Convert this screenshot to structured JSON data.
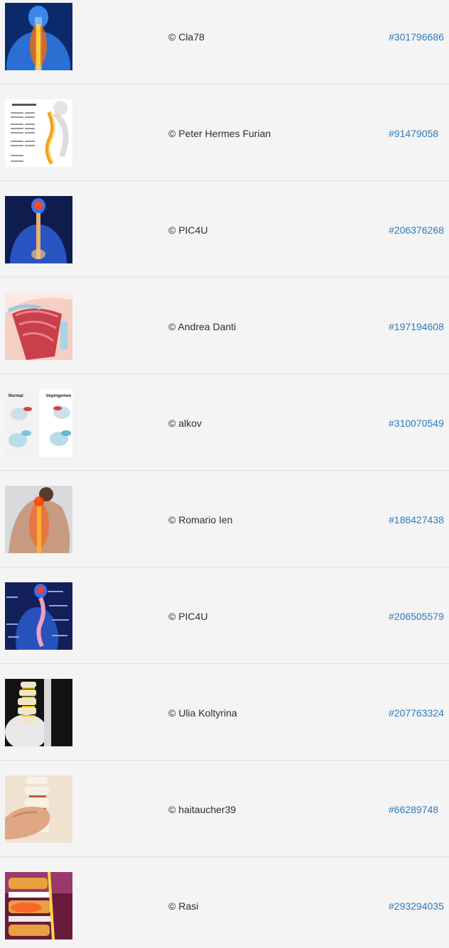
{
  "items": [
    {
      "credit": "© Cla78",
      "id": "#301796686",
      "image": "back-spine-pain-thumbnail"
    },
    {
      "credit": "© Peter Hermes Furian",
      "id": "#91479058",
      "image": "vertebrae-chart-thumbnail"
    },
    {
      "credit": "© PIC4U",
      "id": "#206376268",
      "image": "blue-body-spine-thumbnail"
    },
    {
      "credit": "© Andrea Danti",
      "id": "#197194608",
      "image": "shoulder-muscle-thumbnail"
    },
    {
      "credit": "© alkov",
      "id": "#310070549",
      "image": "shoulder-impingement-diagram-thumbnail",
      "thumb_text": [
        "Normal",
        "Impingemen"
      ]
    },
    {
      "credit": "© Romario Ien",
      "id": "#186427438",
      "image": "man-back-pain-thumbnail"
    },
    {
      "credit": "© PIC4U",
      "id": "#206505579",
      "image": "spine-curves-labeled-thumbnail"
    },
    {
      "credit": "© Ulia Koltyrina",
      "id": "#207763324",
      "image": "skeleton-spine-model-thumbnail"
    },
    {
      "credit": "© haitaucher39",
      "id": "#66289748",
      "image": "hand-holding-spine-thumbnail"
    },
    {
      "credit": "© Rasi",
      "id": "#293294035",
      "image": "lumbar-disc-thumbnail"
    }
  ]
}
